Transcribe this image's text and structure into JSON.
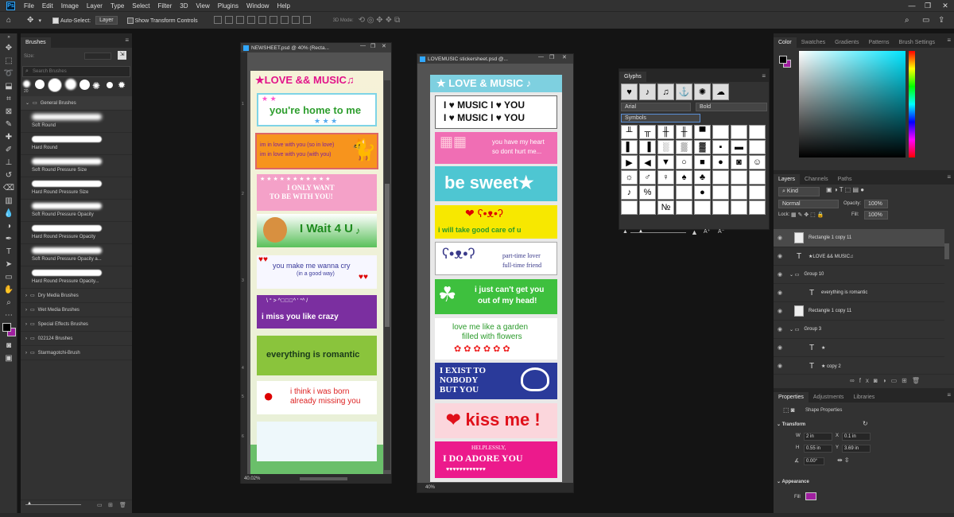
{
  "menu": [
    "File",
    "Edit",
    "Image",
    "Layer",
    "Type",
    "Select",
    "Filter",
    "3D",
    "View",
    "Plugins",
    "Window",
    "Help"
  ],
  "options": {
    "auto_select": "Auto-Select:",
    "auto_select_target": "Layer",
    "show_transform": "Show Transform Controls",
    "mode_3d": "3D Mode:"
  },
  "brushes": {
    "tab": "Brushes",
    "size_label": "Size:",
    "search_placeholder": "Search Brushes",
    "folder_general": "General Brushes",
    "items": [
      "Soft Round",
      "Hard Round",
      "Soft Round Pressure Size",
      "Hard Round Pressure Size",
      "Soft Round Pressure Opacity",
      "Hard Round Pressure Opacity",
      "Soft Round Pressure Opacity a...",
      "Hard Round Pressure Opacity..."
    ],
    "folders": [
      "Dry Media Brushes",
      "Wet Media Brushes",
      "Special Effects Brushes",
      "022124 Brushes",
      "Starmagotchi-Brush"
    ],
    "preset_size": "20"
  },
  "doc1": {
    "title": "NEWSHEET.psd @ 40% (Recta...",
    "zoom": "40.02%",
    "header": "★LOVE && MUSIC♫",
    "s1": "you're home to me",
    "s2a": "im in love with you (so in love)",
    "s2b": "im in love with you (with you)",
    "s3a": "I ONLY WANT",
    "s3b": "TO BE WITH YOU!",
    "s4": "I Wait 4 U",
    "s5a": "you make me wanna cry",
    "s5b": "(in a good way)",
    "s6a": "\\ ° >    ^ﾟ▽ﾟ^ ' °^ /",
    "s6b": "i miss you like crazy",
    "s7": "everything is romantic",
    "s8a": "i think i was born",
    "s8b": "already missing you",
    "ruler": [
      "1",
      "2",
      "3",
      "4",
      "5",
      "6"
    ]
  },
  "doc2": {
    "title": "LOVEMUSIC stickersheet.psd @...",
    "zoom": "40%",
    "header": "★ LOVE & MUSIC ♪",
    "s1a": "I ♥ MUSIC I ♥ YOU",
    "s1b": "I ♥ MUSIC I ♥ YOU",
    "s2a": "you have my heart",
    "s2b": "so dont hurt me...",
    "s3": "be sweet★",
    "s4a": "❤ ʕ•ᴥ•ʔ",
    "s4b": "i will take good care of u",
    "s5a": "part-time lover",
    "s5b": "full-time friend",
    "s6a": "i just can't get you",
    "s6b": "out of my head!",
    "s7a": "love me like a garden",
    "s7b": "filled with flowers",
    "s8a": "I EXIST TO",
    "s8b": "NOBODY",
    "s8c": "BUT YOU",
    "s9": "❤ kiss me !",
    "s10a": "HELPLESSLY,",
    "s10b": "I DO ADORE YOU",
    "s10c": "♥♥♥♥♥♥♥♥♥♥♥♥"
  },
  "glyphs": {
    "title": "Glyphs",
    "font": "Arial",
    "style": "Bold",
    "set": "Symbols",
    "recent": [
      "♥",
      "♪",
      "♫",
      "",
      "",
      ""
    ],
    "grid": [
      [
        "╨",
        "╥",
        "╫",
        "╫",
        "▀"
      ],
      [
        "▌",
        "▐",
        "░",
        "▒",
        "▓"
      ],
      [
        "▶",
        "◀",
        "▼",
        "○",
        "■"
      ],
      [
        "☼",
        "♂",
        "♀",
        "♠",
        "♣"
      ],
      [
        "♪",
        "%",
        "",
        "",
        "●"
      ],
      [
        "",
        "",
        "№",
        "",
        ""
      ]
    ],
    "grid2": [
      [
        "",
        "",
        "",
        "",
        ""
      ],
      [
        "■",
        "□",
        "▪",
        "▬",
        ""
      ],
      [
        "◄",
        "",
        "●",
        "◙",
        "☺"
      ],
      [
        "♥",
        "♦",
        "",
        "",
        ""
      ],
      [
        "○",
        "",
        "",
        "",
        ""
      ],
      [
        "",
        "",
        "",
        "",
        ""
      ]
    ]
  },
  "color_tabs": [
    "Color",
    "Swatches",
    "Gradients",
    "Patterns",
    "Brush Settings"
  ],
  "layers": {
    "tabs": [
      "Layers",
      "Channels",
      "Paths"
    ],
    "kind": "Kind",
    "blend": "Normal",
    "opacity_label": "Opacity:",
    "opacity": "100%",
    "lock_label": "Lock:",
    "fill_label": "Fill:",
    "fill": "100%",
    "items": [
      {
        "name": "Rectangle 1 copy 11",
        "type": "shape"
      },
      {
        "name": "★LOVE && MUSIC♫",
        "type": "text"
      },
      {
        "name": "Group 10",
        "type": "group"
      },
      {
        "name": "everything is romantic",
        "type": "text"
      },
      {
        "name": "Rectangle 1 copy 11",
        "type": "shape"
      },
      {
        "name": "Group 3",
        "type": "group"
      },
      {
        "name": "★",
        "type": "text"
      },
      {
        "name": "★ copy 2",
        "type": "text"
      }
    ]
  },
  "properties": {
    "tabs": [
      "Properties",
      "Adjustments",
      "Libraries"
    ],
    "kind": "Shape Properties",
    "transform": "Transform",
    "w_label": "W",
    "w": "2 in",
    "x_label": "X",
    "x": "0.1 in",
    "h_label": "H",
    "h": "0.55 in",
    "y_label": "Y",
    "y": "3.69 in",
    "angle": "0.00°",
    "appearance": "Appearance",
    "fill_label": "Fill",
    "fill_color": "#a020a0"
  }
}
